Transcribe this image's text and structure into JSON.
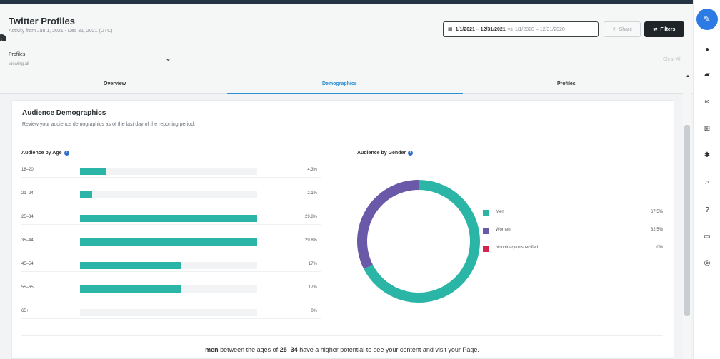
{
  "header": {
    "title": "Twitter Profiles",
    "subtitle": "Activity from Jan 1, 2021 - Dec 31, 2021 (UTC)",
    "date_range": "1/1/2021 – 12/31/2021",
    "date_vs": "vs",
    "date_compare": "1/1/2020 – 12/31/2020",
    "share_label": "Share",
    "filters_label": "Filters"
  },
  "profiles": {
    "label": "Profiles",
    "sub": "Viewing all",
    "clear_label": "Clear All"
  },
  "tabs": [
    {
      "label": "Overview"
    },
    {
      "label": "Demographics"
    },
    {
      "label": "Profiles"
    }
  ],
  "panel": {
    "title": "Audience Demographics",
    "subtitle": "Review your audience demographics as of the last day of the reporting period."
  },
  "age": {
    "title": "Audience by Age",
    "rows": [
      {
        "label": "18–20",
        "value": 4.3,
        "display": "4.3%"
      },
      {
        "label": "21–24",
        "value": 2.1,
        "display": "2.1%"
      },
      {
        "label": "25–34",
        "value": 29.8,
        "display": "29.8%"
      },
      {
        "label": "35–44",
        "value": 29.8,
        "display": "29.8%"
      },
      {
        "label": "45–54",
        "value": 17,
        "display": "17%"
      },
      {
        "label": "55–65",
        "value": 17,
        "display": "17%"
      },
      {
        "label": "65+",
        "value": 0,
        "display": "0%"
      }
    ]
  },
  "gender": {
    "title": "Audience by Gender",
    "items": [
      {
        "label": "Men",
        "value": 67.5,
        "display": "67.5%",
        "color": "#2bb5a6"
      },
      {
        "label": "Women",
        "value": 32.5,
        "display": "32.5%",
        "color": "#6a58a9"
      },
      {
        "label": "Nonbinary/unspecified",
        "value": 0,
        "display": "0%",
        "color": "#d6244e"
      }
    ]
  },
  "insight": {
    "gender": "men",
    "text_1": "between the ages of",
    "age": "25–34",
    "text_2": "have a higher potential to see your content and visit your Page."
  },
  "colors": {
    "accent": "#2c7be5",
    "teal": "#2bb5a6",
    "purple": "#6a58a9",
    "tab_underline": "#2c8fd6"
  },
  "rail": {
    "icons": [
      "compose-icon",
      "bell-icon",
      "chat-icon",
      "link-icon",
      "plus-box-icon",
      "gear-icon",
      "search-icon",
      "help-icon",
      "inbox-icon",
      "globe-icon"
    ]
  }
}
